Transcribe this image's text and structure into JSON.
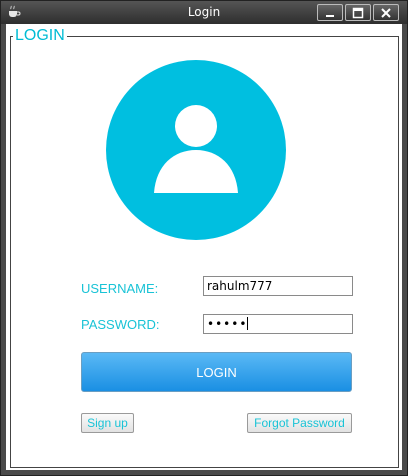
{
  "window": {
    "title": "Login",
    "icons": {
      "app": "coffee-cup-icon",
      "minimize": "minimize-icon",
      "maximize": "maximize-icon",
      "close": "close-icon"
    }
  },
  "form": {
    "group_title": "LOGIN",
    "avatar_icon": "user-avatar-icon",
    "username_label": "USERNAME:",
    "username_value": "rahulm777",
    "password_label": "PASSWORD:",
    "password_masked": "•••••",
    "login_label": "LOGIN",
    "signup_label": "Sign up",
    "forgot_label": "Forgot Password"
  },
  "colors": {
    "accent": "#00bfe0",
    "label_text": "#19c3d6",
    "button_top": "#5ab9f5",
    "button_bottom": "#1a8fe3",
    "titlebar": "#3a3a3a"
  }
}
